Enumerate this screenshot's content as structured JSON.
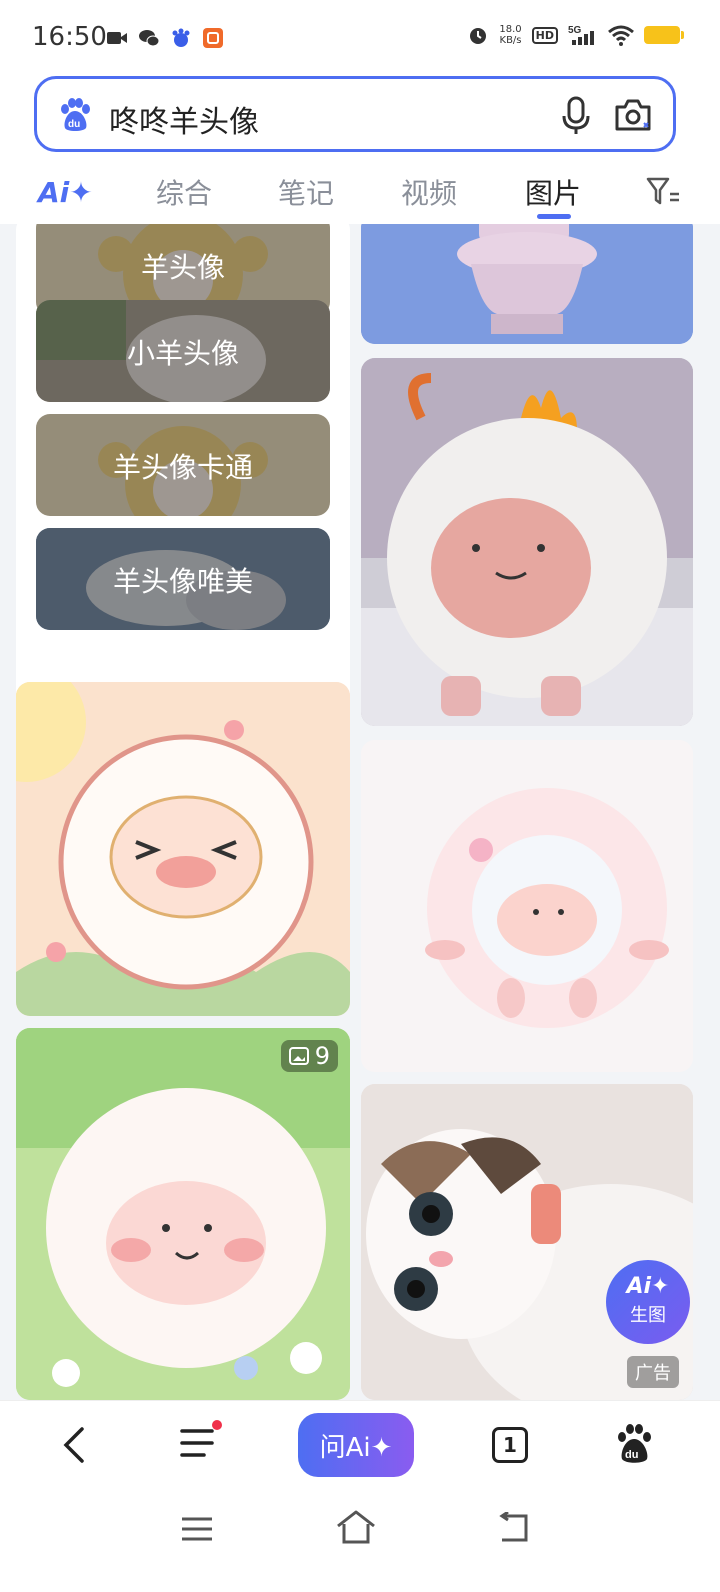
{
  "status_bar": {
    "time": "16:50",
    "net_speed_value": "18.0",
    "net_speed_unit": "KB/s",
    "hd": "HD",
    "network": "5G"
  },
  "search": {
    "query": "咚咚羊头像"
  },
  "tabs": {
    "ai": "Ai✦",
    "items": [
      "综合",
      "笔记",
      "视频",
      "图片"
    ],
    "active": "图片"
  },
  "related": [
    "羊头像",
    "小羊头像",
    "羊头像卡通",
    "羊头像唯美"
  ],
  "grid": {
    "count_badge": "9",
    "ad_label": "广告"
  },
  "fab": {
    "line1": "Ai✦",
    "line2": "生图"
  },
  "bottom_nav": {
    "ask_ai": "问Ai✦",
    "tab_count": "1"
  },
  "colors": {
    "accent": "#4e6ef2"
  }
}
